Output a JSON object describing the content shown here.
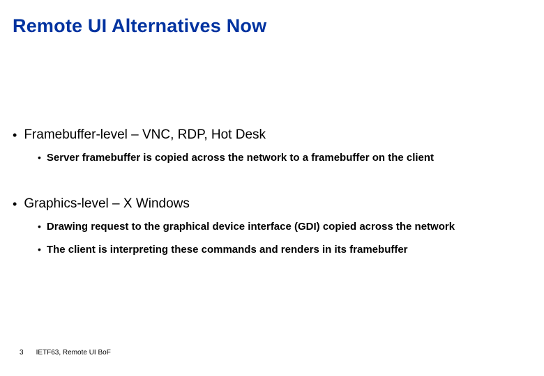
{
  "title": "Remote UI Alternatives Now",
  "sections": [
    {
      "heading": "Framebuffer-level – VNC, RDP, Hot Desk",
      "items": [
        "Server framebuffer is copied across the network to a framebuffer on the client"
      ]
    },
    {
      "heading": "Graphics-level – X Windows",
      "items": [
        "Drawing request to the graphical device interface (GDI) copied across the network",
        "The client is interpreting these commands and renders in its framebuffer"
      ]
    }
  ],
  "footer": {
    "page_number": "3",
    "text": "IETF63, Remote UI BoF"
  }
}
